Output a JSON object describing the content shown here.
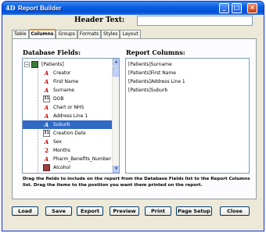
{
  "window": {
    "title": "Report Builder",
    "app_icon": "4D"
  },
  "header": {
    "label": "Header Text:",
    "value": ""
  },
  "tabs": [
    {
      "label": "Table",
      "active": false
    },
    {
      "label": "Columns",
      "active": true
    },
    {
      "label": "Groups",
      "active": false
    },
    {
      "label": "Formats",
      "active": false
    },
    {
      "label": "Styles",
      "active": false
    },
    {
      "label": "Layout",
      "active": false
    }
  ],
  "database_fields": {
    "label": "Database Fields:",
    "table": "[Patients]",
    "fields": [
      {
        "name": "Creator",
        "icon": "text-field-icon"
      },
      {
        "name": "First Name",
        "icon": "text-field-icon"
      },
      {
        "name": "Surname",
        "icon": "text-field-icon"
      },
      {
        "name": "DOB",
        "icon": "date-field-icon"
      },
      {
        "name": "Chart or NHS",
        "icon": "text-field-icon"
      },
      {
        "name": "Address Line 1",
        "icon": "text-field-icon"
      },
      {
        "name": "Suburb",
        "icon": "text-field-icon",
        "selected": true
      },
      {
        "name": "Creation Date",
        "icon": "date-field-icon"
      },
      {
        "name": "Sex",
        "icon": "text-field-icon"
      },
      {
        "name": "Months",
        "icon": "number-field-icon"
      },
      {
        "name": "Pharm_Benefits_Number",
        "icon": "text-field-icon"
      },
      {
        "name": "Alcohol",
        "icon": "picture-field-icon"
      },
      {
        "name": "Account ID",
        "icon": "text-field-icon"
      }
    ]
  },
  "report_columns": {
    "label": "Report Columns:",
    "items": [
      "[Patients]Surname",
      "[Patients]First Name",
      "[Patients]Address Line 1",
      "[Patients]Suburb"
    ]
  },
  "help_text": "Drag the fields to include on the report from the Database Fields list to the Report Columns list. Drag the items to the position you want them printed on the report.",
  "buttons": {
    "load": "Load",
    "save": "Save",
    "export": "Export",
    "preview": "Preview",
    "print": "Print",
    "page_setup": "Page Setup",
    "close": "Close"
  },
  "colors": {
    "selection": "#316ac5",
    "titlebar": "#0a5ee0",
    "window_bg": "#ece9d8"
  }
}
